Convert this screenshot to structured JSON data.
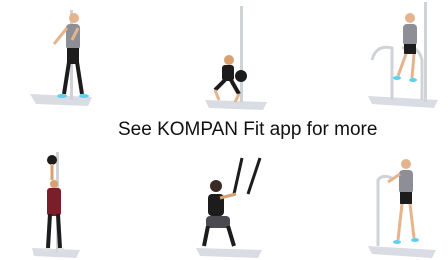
{
  "caption": "See KOMPAN Fit app for more",
  "exercises": [
    {
      "icon": "standing-pole-stretch-figure"
    },
    {
      "icon": "kettlebell-squat-figure"
    },
    {
      "icon": "parallel-bar-dip-figure"
    },
    {
      "icon": "overhead-kettlebell-reach-figure"
    },
    {
      "icon": "suspension-strap-squat-figure"
    },
    {
      "icon": "standing-pole-balance-figure"
    }
  ],
  "colors": {
    "pole": "#cfd3d8",
    "shadow": "#d9dce3",
    "skin": "#e6b48c",
    "shirt_gray": "#8e8e96",
    "shorts_black": "#1c1c1c",
    "shoe_cyan": "#5fd0f0",
    "shirt_maroon": "#7a1f2a"
  }
}
